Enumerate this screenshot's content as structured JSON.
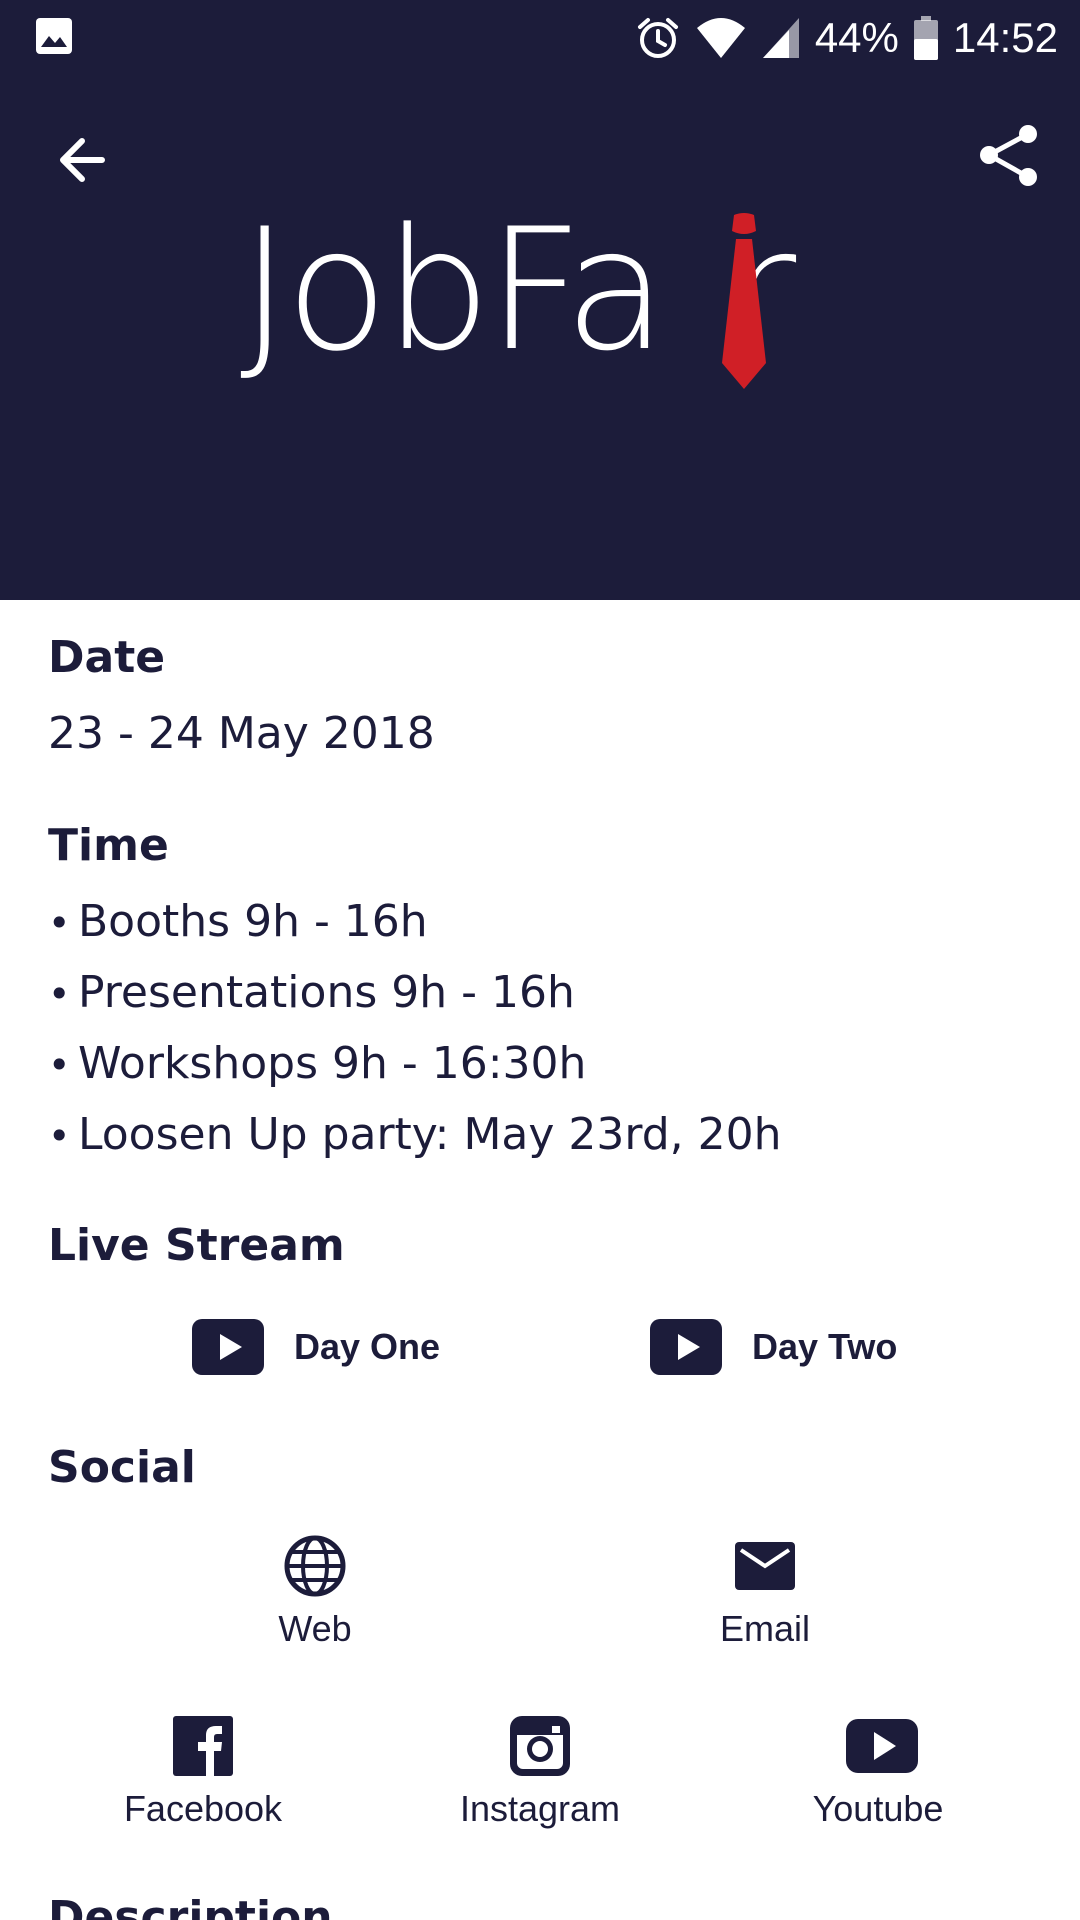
{
  "status_bar": {
    "battery_percent": "44%",
    "time": "14:52",
    "icons": [
      "gallery-icon",
      "alarm-icon",
      "wifi-icon",
      "signal-icon",
      "battery-icon"
    ]
  },
  "header": {
    "logo_text": "JobFair",
    "logo_text_before": "JobFa",
    "logo_text_after": "r",
    "accent_color": "#d01f26",
    "background_color": "#1c1c3a"
  },
  "date": {
    "title": "Date",
    "value": "23 - 24 May 2018"
  },
  "time": {
    "title": "Time",
    "items": [
      "Booths 9h - 16h",
      "Presentations 9h - 16h",
      "Workshops 9h - 16:30h",
      "Loosen Up party: May 23rd, 20h"
    ]
  },
  "live_stream": {
    "title": "Live Stream",
    "buttons": [
      {
        "label": "Day One",
        "icon": "play-icon"
      },
      {
        "label": "Day Two",
        "icon": "play-icon"
      }
    ]
  },
  "social": {
    "title": "Social",
    "items": [
      {
        "label": "Web",
        "icon": "globe-icon"
      },
      {
        "label": "Email",
        "icon": "email-icon"
      },
      {
        "label": "Facebook",
        "icon": "facebook-icon"
      },
      {
        "label": "Instagram",
        "icon": "instagram-icon"
      },
      {
        "label": "Youtube",
        "icon": "youtube-icon"
      }
    ]
  },
  "description": {
    "title": "Description"
  }
}
